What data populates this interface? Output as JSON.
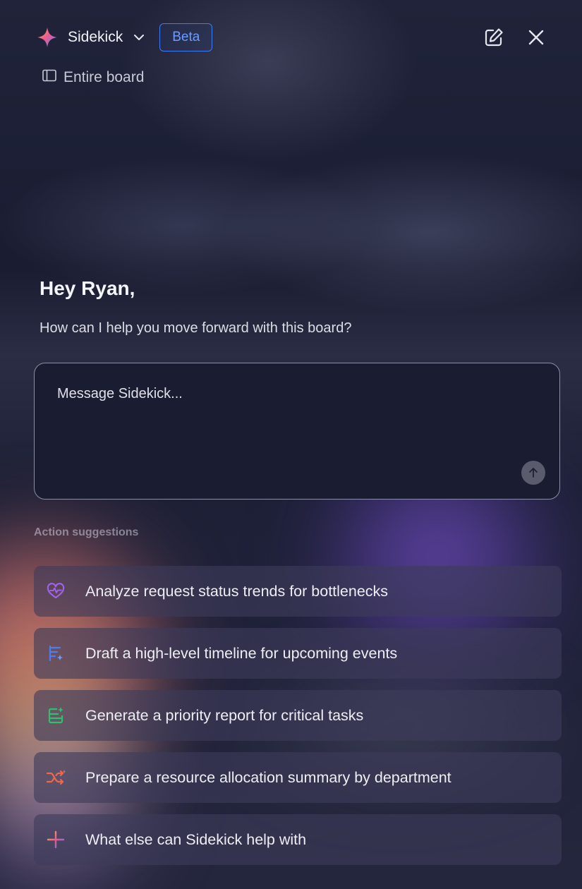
{
  "header": {
    "title": "Sidekick",
    "badge": "Beta",
    "scope_label": "Entire board"
  },
  "greeting": {
    "title": "Hey Ryan,",
    "subtitle": "How can I help you move forward with this board?"
  },
  "composer": {
    "placeholder": "Message Sidekick..."
  },
  "suggestions": {
    "section_label": "Action suggestions",
    "items": [
      {
        "label": "Analyze request status trends for bottlenecks",
        "icon": "heartbeat-icon",
        "color": "#a463f2"
      },
      {
        "label": "Draft a high-level timeline for upcoming events",
        "icon": "timeline-icon",
        "color": "#4e7df0"
      },
      {
        "label": "Generate a priority report for critical tasks",
        "icon": "report-sparkle-icon",
        "color": "#2fbf71"
      },
      {
        "label": "Prepare a resource allocation summary by department",
        "icon": "shuffle-icon",
        "color": "#f0674b"
      },
      {
        "label": "What else can Sidekick help with",
        "icon": "plus-icon",
        "color": "#8d7cf5"
      }
    ]
  },
  "colors": {
    "accent": "#3d7cf5",
    "background": "#1b1d33"
  }
}
